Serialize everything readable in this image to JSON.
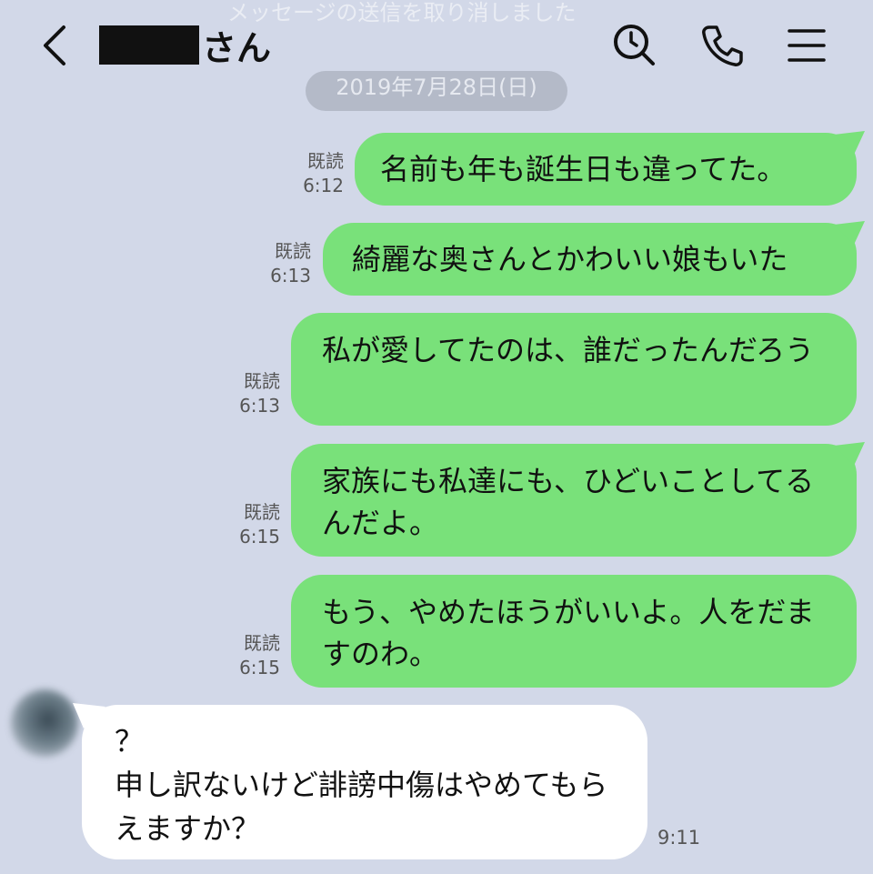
{
  "header": {
    "contact_suffix": "さん",
    "system_message": "メッセージの送信を取り消しました",
    "icons": [
      "back-icon",
      "search-icon",
      "phone-icon",
      "menu-icon"
    ]
  },
  "date_label": "2019年7月28日(日)",
  "outgoing": [
    {
      "status": "既読",
      "time": "6:12",
      "text": "名前も年も誕生日も違ってた。"
    },
    {
      "status": "既読",
      "time": "6:13",
      "text": "綺麗な奥さんとかわいい娘もいた"
    },
    {
      "status": "既読",
      "time": "6:13",
      "text": "私が愛してたのは、誰だったんだろう"
    },
    {
      "status": "既読",
      "time": "6:15",
      "text": "家族にも私達にも、ひどいことしてるんだよ。"
    },
    {
      "status": "既読",
      "time": "6:15",
      "text": "もう、やめたほうがいいよ。人をだますのわ。"
    }
  ],
  "incoming": {
    "text": "？\n申し訳ないけど誹謗中傷はやめてもらえますか？",
    "time": "9:11"
  },
  "colors": {
    "background": "#d2d8e8",
    "outgoing_bubble": "#79e17a",
    "incoming_bubble": "#ffffff"
  }
}
